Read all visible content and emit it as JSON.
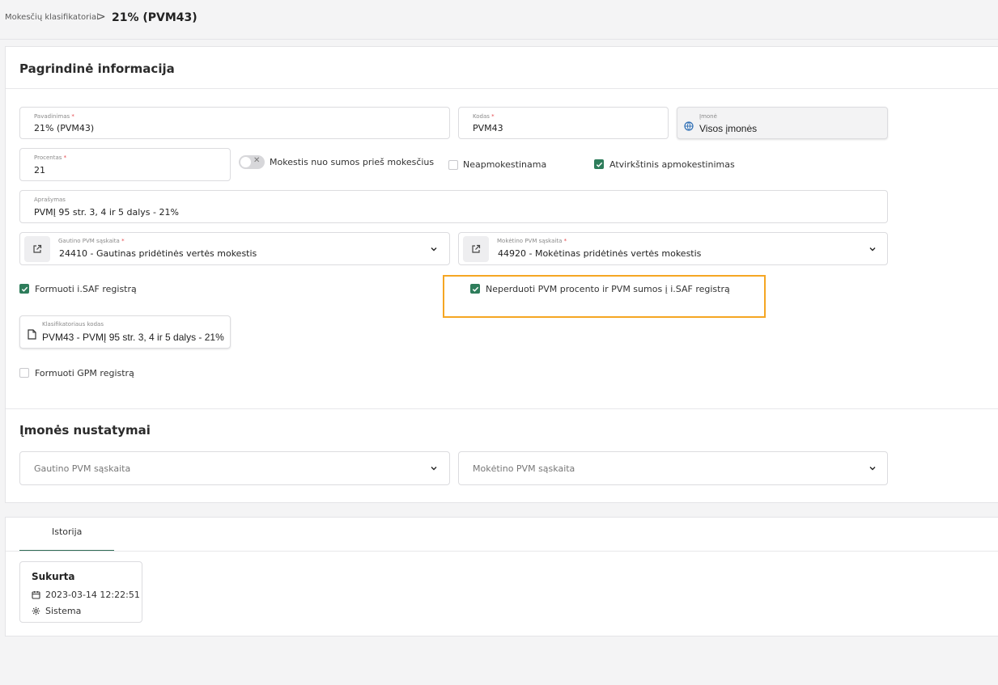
{
  "breadcrumb": {
    "parent": "Mokesčių klasifikatoriai",
    "separator": ">",
    "current": "21% (PVM43)"
  },
  "main": {
    "section_title": "Pagrindinė informacija",
    "name_field": {
      "label": "Pavadinimas",
      "required": "*",
      "value": "21% (PVM43)"
    },
    "code_field": {
      "label": "Kodas",
      "required": "*",
      "value": "PVM43"
    },
    "company_field": {
      "label": "Įmonė",
      "value": "Visos įmonės",
      "icon": "globe-icon"
    },
    "percent_field": {
      "label": "Procentas",
      "required": "*",
      "value": "21"
    },
    "toggle_label": "Mokestis nuo sumos prieš mokesčius",
    "toggle_on": false,
    "checkbox_untaxed": {
      "label": "Neapmokestinama",
      "checked": false
    },
    "checkbox_reverse": {
      "label": "Atvirkštinis apmokestinimas",
      "checked": true
    },
    "description_field": {
      "label": "Aprašymas",
      "value": "PVMĮ 95 str. 3, 4 ir 5 dalys - 21%"
    },
    "receivable_account": {
      "label": "Gautino PVM sąskaita",
      "required": "*",
      "value": "24410 - Gautinas pridėtinės vertės mokestis",
      "icon": "external-link-icon"
    },
    "payable_account": {
      "label": "Mokėtino PVM sąskaita",
      "required": "*",
      "value": "44920 - Mokėtinas pridėtinės vertės mokestis",
      "icon": "external-link-icon"
    },
    "checkbox_isaf": {
      "label": "Formuoti i.SAF registrą",
      "checked": true
    },
    "checkbox_no_transfer": {
      "label": "Neperduoti PVM procento ir PVM sumos į i.SAF registrą",
      "checked": true
    },
    "classifier_field": {
      "label": "Klasifikatoriaus kodas",
      "value": "PVM43 - PVMĮ 95 str. 3, 4 ir 5 dalys - 21%",
      "icon": "document-icon"
    },
    "checkbox_gpm": {
      "label": "Formuoti GPM registrą",
      "checked": false
    }
  },
  "company_settings": {
    "section_title": "Įmonės nustatymai",
    "receivable_placeholder": "Gautino PVM sąskaita",
    "payable_placeholder": "Mokėtino PVM sąskaita"
  },
  "history": {
    "tab_label": "Istorija",
    "entry": {
      "title": "Sukurta",
      "datetime": "2023-03-14 12:22:51",
      "user": "Sistema"
    }
  },
  "colors": {
    "accent_green": "#2e7d5b",
    "highlight": "#f5a623",
    "required": "#e5484d"
  }
}
